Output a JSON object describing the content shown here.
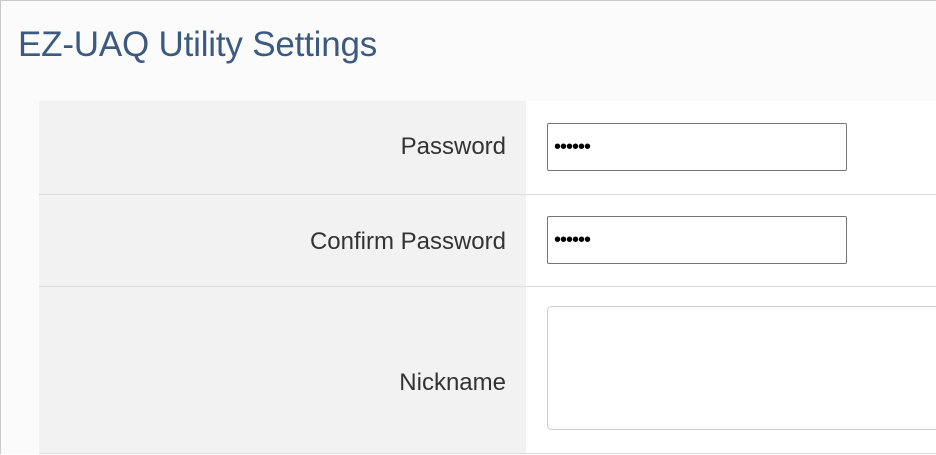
{
  "page": {
    "title": "EZ-UAQ Utility Settings"
  },
  "form": {
    "password": {
      "label": "Password",
      "value": "••••••"
    },
    "confirm_password": {
      "label": "Confirm Password",
      "value": "••••••"
    },
    "nickname": {
      "label": "Nickname",
      "value": ""
    }
  },
  "colors": {
    "title": "#3c5a80",
    "label_cell_bg": "#f2f2f2",
    "value_cell_bg": "#ffffff",
    "row_divider": "#dcdcdc"
  }
}
